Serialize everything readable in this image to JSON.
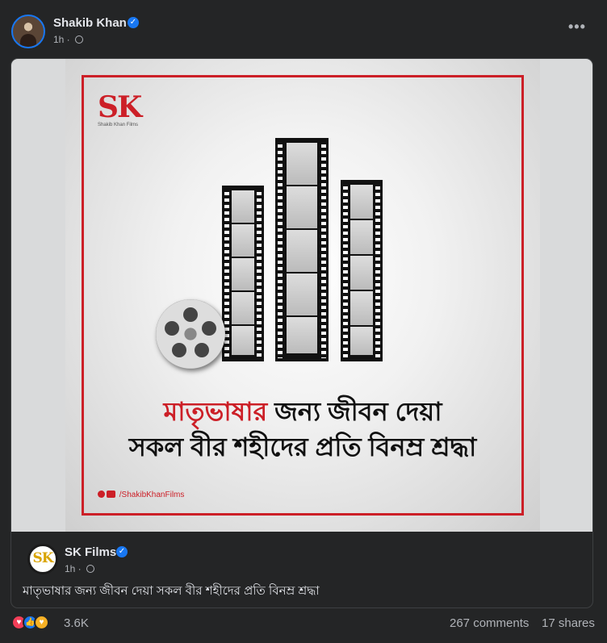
{
  "post": {
    "author": "Shakib Khan",
    "time": "1h ·",
    "more": "•••"
  },
  "shared": {
    "poster": {
      "logo": "SK",
      "logo_sub": "Shakib Khan Films",
      "headline_red": "মাতৃভাষার",
      "headline_rest": " জন্য জীবন দেয়া",
      "headline_line2": "সকল বীর শহীদের প্রতি বিনম্র শ্রদ্ধা",
      "social_handle": "/ShakibKhanFilms"
    },
    "avatar_text": "SK",
    "author": "SK Films",
    "time": "1h ·",
    "text": "মাতৃভাষার জন্য জীবন দেয়া সকল বীর শহীদের প্রতি বিনম্র শ্রদ্ধা"
  },
  "footer": {
    "reaction_count": "3.6K",
    "comments": "267 comments",
    "shares": "17 shares"
  },
  "colors": {
    "background": "#242526",
    "verified": "#1877f2",
    "poster_red": "#cc1f27"
  },
  "icons": [
    "verified-icon",
    "globe-icon",
    "more-icon",
    "love-icon",
    "like-icon",
    "care-icon"
  ]
}
